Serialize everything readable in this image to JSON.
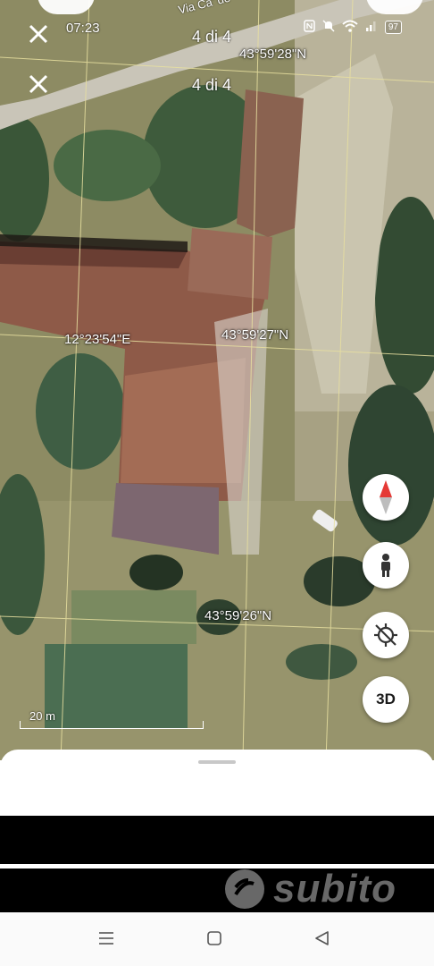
{
  "status_bar": {
    "time": "07:23",
    "battery": "97",
    "icons": [
      "nfc-icon",
      "mute-icon",
      "wifi-icon",
      "signal-icon",
      "battery-icon"
    ]
  },
  "viewer": {
    "counter_top": "4 di 4",
    "counter_second": "4 di 4"
  },
  "map": {
    "road_label": "Via Ca' de",
    "lat_labels": [
      "43°59'28\"N",
      "43°59'27\"N",
      "43°59'26\"N"
    ],
    "lon_label": "12°23'54\"E",
    "scale_label": "20 m",
    "controls": {
      "three_d_label": "3D"
    },
    "colors": {
      "grid_line": "#e8e0a0",
      "roof": "#8e5a48",
      "road": "#c9c5b8"
    }
  },
  "watermark": {
    "text": "subito"
  },
  "navbar": {
    "icons": [
      "menu-icon",
      "home-square-icon",
      "back-triangle-icon"
    ]
  }
}
